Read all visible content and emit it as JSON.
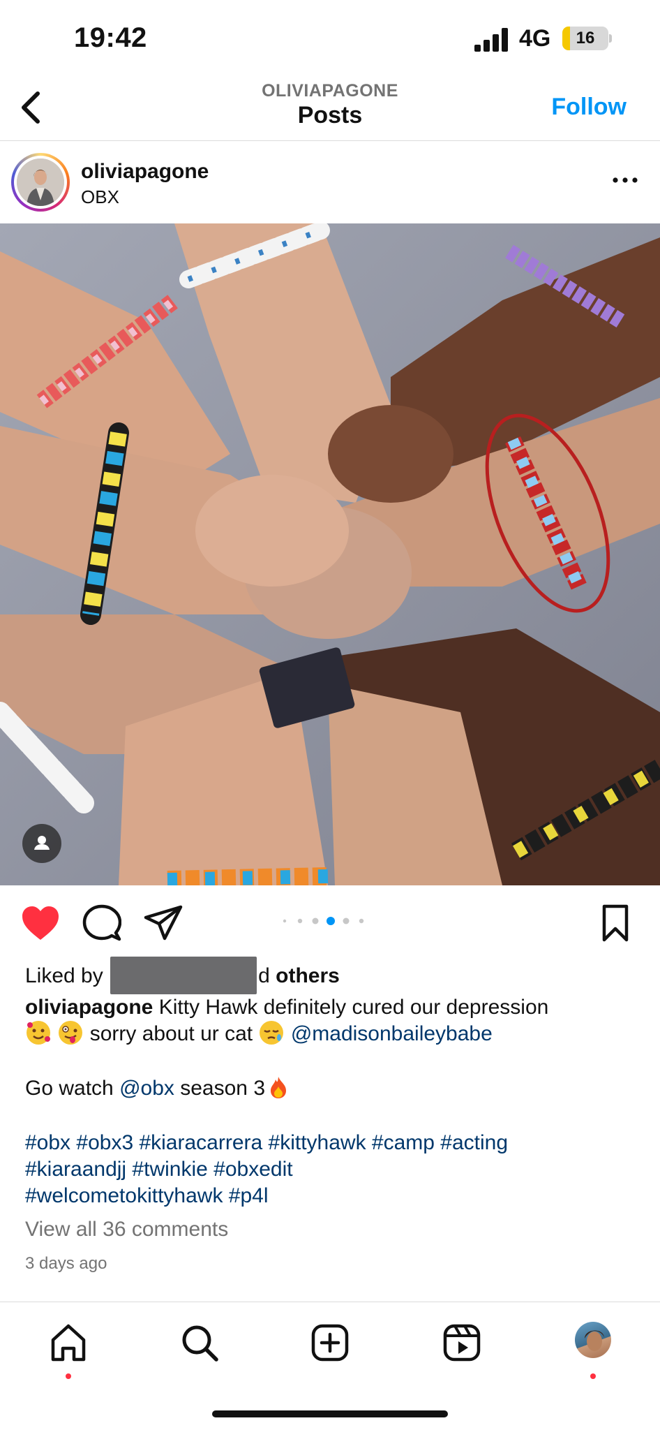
{
  "status_bar": {
    "time": "19:42",
    "network": "4G",
    "battery": "16",
    "battery_level": 0.16
  },
  "header": {
    "subtitle": "OLIVIAPAGONE",
    "title": "Posts",
    "follow_label": "Follow"
  },
  "post": {
    "username": "oliviapagone",
    "location": "OBX",
    "carousel": {
      "count": 6,
      "active_index": 3
    },
    "likes": {
      "prefix": "Liked by",
      "suffix": "d",
      "others": "others"
    },
    "caption": {
      "username": "oliviapagone",
      "line1": "Kitty Hawk definitely cured our depression",
      "line2": "sorry about ur cat",
      "mention1": "@madisonbaileybabe",
      "watch_prefix": "Go watch",
      "mention2": "@obx",
      "watch_suffix": "season 3",
      "hashtags_line1": "#obx #obx3 #kiaracarrera #kittyhawk #camp #acting",
      "hashtags_line2": "#kiaraandjj #twinkie #obxedit",
      "hashtags_line3": "#welcometokittyhawk #p4l"
    },
    "view_comments": "View all 36 comments",
    "time_ago": "3 days ago"
  },
  "colors": {
    "accent": "#0095f6",
    "like_red": "#ff3040",
    "link": "#00376b",
    "muted": "#737373"
  },
  "icons": [
    "back-chevron-icon",
    "more-icon",
    "heart-icon",
    "comment-icon",
    "share-icon",
    "bookmark-icon",
    "home-icon",
    "search-icon",
    "create-icon",
    "reels-icon",
    "profile-avatar"
  ]
}
